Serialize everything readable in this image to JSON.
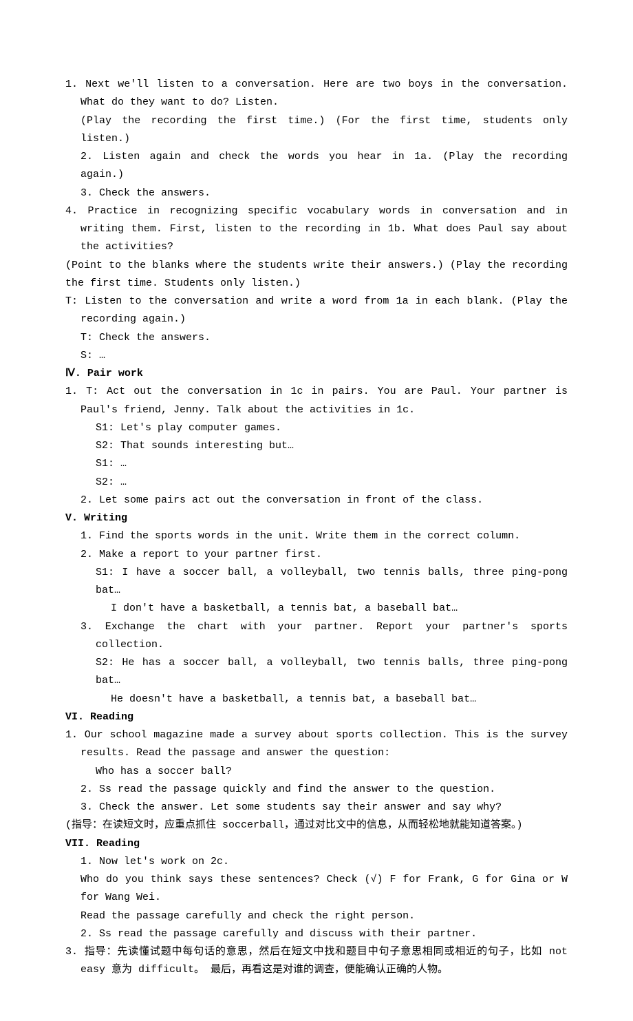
{
  "lines": [
    {
      "cls": "line indent-1",
      "text": "1. Next we'll listen to a conversation. Here are two boys in the conversation. What do they want to do? Listen."
    },
    {
      "cls": "line indent-1b",
      "text": "(Play the recording the first time.) (For the first time, students only listen.)"
    },
    {
      "cls": "line indent-1b",
      "text": "2. Listen again and check the words you hear in 1a. (Play the recording again.)"
    },
    {
      "cls": "line indent-1b",
      "text": "3. Check the answers."
    },
    {
      "cls": "line indent-1",
      "text": "4. Practice in recognizing specific vocabulary words in conversation and in writing them. First, listen to the recording in 1b. What does Paul say about the activities?"
    },
    {
      "cls": "line",
      "text": "(Point to the blanks where the students write their answers.) (Play the recording the first time. Students only listen.)"
    },
    {
      "cls": "line indent-1",
      "text": "T: Listen to the conversation and write a word from 1a in each blank. (Play the recording again.)"
    },
    {
      "cls": "line indent-1b",
      "text": "T: Check the answers."
    },
    {
      "cls": "line indent-1b",
      "text": "S: …"
    },
    {
      "cls": "line section-head",
      "text": "Ⅳ.  Pair work"
    },
    {
      "cls": "line indent-1",
      "text": "1. T: Act out the conversation in 1c in pairs. You are Paul. Your partner is Paul's friend, Jenny. Talk about the activities in 1c."
    },
    {
      "cls": "line indent-2b",
      "text": "S1: Let's play computer games."
    },
    {
      "cls": "line indent-2b",
      "text": "S2: That sounds interesting but…"
    },
    {
      "cls": "line indent-2b",
      "text": "S1: …"
    },
    {
      "cls": "line indent-2b",
      "text": "S2: …"
    },
    {
      "cls": "line indent-1b",
      "text": "2. Let some pairs act out the conversation in front of the class."
    },
    {
      "cls": "line section-head",
      "text": "V. Writing"
    },
    {
      "cls": "line indent-1b",
      "text": "1. Find the sports words in the unit. Write them in the correct column."
    },
    {
      "cls": "line indent-1b",
      "text": "2. Make a report to your partner first."
    },
    {
      "cls": "line indent-2b",
      "text": "S1: I have a soccer ball, a volleyball, two tennis balls, three ping-pong bat…"
    },
    {
      "cls": "line indent-3b",
      "text": "I don't have a basketball, a tennis bat, a baseball bat…"
    },
    {
      "cls": "line indent-2",
      "text": "3. Exchange the chart with your partner. Report your partner's sports collection."
    },
    {
      "cls": "line indent-2b",
      "text": "S2: He has a soccer ball, a volleyball, two tennis balls, three ping-pong bat…"
    },
    {
      "cls": "line indent-3b",
      "text": "He doesn't have a basketball, a tennis bat, a baseball bat…"
    },
    {
      "cls": "line section-head",
      "text": "VI. Reading"
    },
    {
      "cls": "line indent-1",
      "text": "1. Our school magazine made a survey about sports collection. This is the survey results. Read the passage and answer the question:"
    },
    {
      "cls": "line indent-2b",
      "text": "Who has a soccer ball?"
    },
    {
      "cls": "line indent-1b",
      "text": "2. Ss read the passage quickly and find the answer to the question."
    },
    {
      "cls": "line indent-1b",
      "text": "3. Check the answer. Let some students say their answer and say why?"
    },
    {
      "cls": "line",
      "text": "(指导：在读短文时，应重点抓住 soccerball，通过对比文中的信息，从而轻松地就能知道答案。)"
    },
    {
      "cls": "line section-head",
      "text": "VII. Reading"
    },
    {
      "cls": "line indent-1b",
      "text": "1. Now let's work on 2c."
    },
    {
      "cls": "line indent-1b",
      "text": " Who do you think says these sentences? Check (√) F for Frank, G for Gina or W for Wang Wei."
    },
    {
      "cls": "line indent-1b",
      "text": " Read the passage carefully and check the right person."
    },
    {
      "cls": "line indent-1b",
      "text": "2. Ss read the passage carefully and discuss with their partner."
    },
    {
      "cls": "line indent-1",
      "text": "3. 指导：先读懂试题中每句话的意思，然后在短文中找和题目中句子意思相同或相近的句子，比如 not easy 意为 difficult。 最后，再看这是对谁的调查，便能确认正确的人物。"
    }
  ]
}
